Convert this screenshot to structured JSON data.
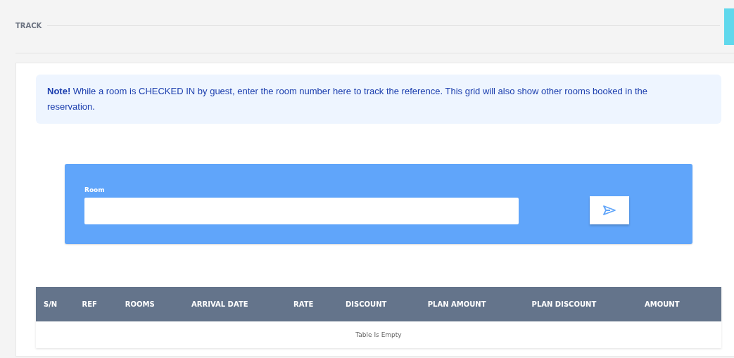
{
  "section": {
    "title": "TRACK"
  },
  "note": {
    "text": "**Note!** While a room is CHECKED IN by guest, enter the room number here to track the reference. This grid will also show other rooms booked in the reservation."
  },
  "form": {
    "field_label": "Room"
  },
  "table": {
    "columns": [
      "S/N",
      "REF",
      "ROOMS",
      "ARRIVAL DATE",
      "RATE",
      "DISCOUNT",
      "PLAN AMOUNT",
      "PLAN DISCOUNT",
      "AMOUNT"
    ],
    "empty_message": "Table Is Empty"
  }
}
